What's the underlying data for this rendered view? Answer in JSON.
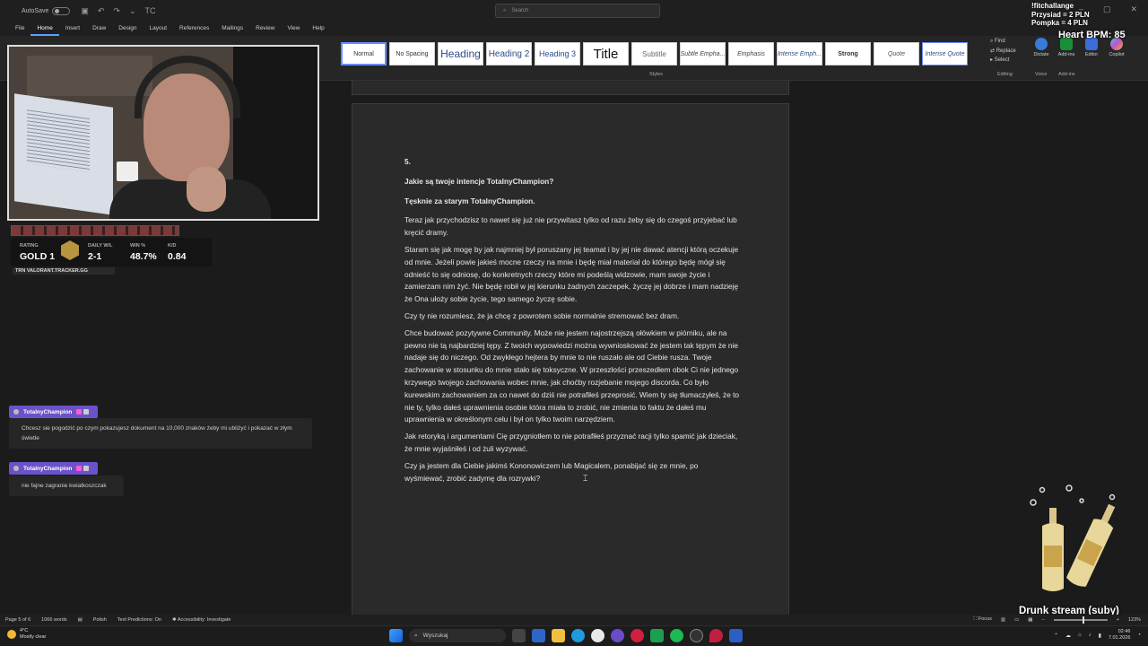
{
  "titlebar": {
    "autosave": "AutoSave",
    "search_placeholder": "Search",
    "quick_access_label": "TC"
  },
  "menu": [
    "File",
    "Home",
    "Insert",
    "Draw",
    "Design",
    "Layout",
    "References",
    "Mailings",
    "Review",
    "View",
    "Help"
  ],
  "ribbon": {
    "styles": [
      "Normal",
      "No Spacing",
      "Heading",
      "Heading 2",
      "Heading 3",
      "Title",
      "Subtitle",
      "Subtle Empha...",
      "Emphasis",
      "Intense Emph...",
      "Strong",
      "Quote",
      "Intense Quote"
    ],
    "styles_label": "Styles",
    "editing": [
      "Find",
      "Replace",
      "Select"
    ],
    "editing_label": "Editing",
    "voice": "Dictate",
    "voice_label": "Voice",
    "addins": [
      "Add-ins",
      "Editor",
      "Copilot"
    ],
    "addins_label": "Add-ins"
  },
  "document": {
    "number": "5.",
    "heading": "Jakie są twoje intencje TotalnyChampion?",
    "subheading": "Tęsknie za starym TotalnyChampion.",
    "paragraphs": [
      "Teraz jak przychodzisz to nawet się już nie przywitasz tylko od razu żeby się do czegoś przyjebać lub kręcić dramy.",
      "Staram się jak mogę by jak najmniej był poruszany jej teamat i by jej nie dawać atencji którą oczekuje od mnie. Jeżeli powie jakieś mocne rzeczy na mnie i będę miał materiał do którego będę mógł się odnieść to się odniosę, do konkretnych rzeczy które mi podeślą widzowie, mam swoje życie i zamierzam nim żyć. Nie będę robił w jej kierunku żadnych zaczepek, życzę jej dobrze i mam nadzieję że Ona ułoży sobie życie, tego samego życzę sobie.",
      "Czy ty nie rozumiesz, że ja chcę z powrotem sobie normalnie stremować bez dram.",
      "Chce budować pozytywne Community. Może nie jestem najostrzejszą ołówkiem w piórniku, ale na pewno nie tą najbardziej tępy. Z twoich wypowiedzi można wywnioskować że jestem tak tępym że nie nadaje się do niczego. Od zwykłego hejtera by mnie to nie ruszało ale od Ciebie rusza. Twoje zachowanie w stosunku do mnie stało się toksyczne. W przeszłości przeszedłem obok Ci nie jednego krzywego twojego zachowania wobec mnie, jak choćby rozjebanie mojego discorda. Co było kurewskim zachowaniem za co nawet do dziś nie potrafiłeś przeprosić.  Wiem ty się tłumaczyłeś, że to nie ty, tylko dałeś uprawnienia osobie która miała to zrobić, nie zmienia to faktu że dałeś mu uprawnienia w określonym celu i był on tylko twoim narzędziem.",
      "Jak retoryką i argumentami Cię przygniotłem to nie potrafiłeś przyznać racji tylko spamić jak dzieciak, że mnie wyjaśniłeś i od żuli wyzywać.",
      "Czy ja jestem dla Ciebie jakimś Kononowiczem lub Magicalem, ponabijać się ze mnie, po wyśmiewać, zrobić zadymę dla rozrywki?"
    ]
  },
  "tracker": {
    "rating_label": "RATING",
    "rating_value": "GOLD 1",
    "daily_label": "DAILY W/L",
    "daily_value": "2-1",
    "win_label": "WIN %",
    "win_value": "48.7%",
    "kd_label": "K/D",
    "kd_value": "0.84",
    "brand": "TRN  VALORANT.TRACKER.GG"
  },
  "chat": [
    {
      "user": "TotalnyChampion",
      "message": "Chcesz sie pogodzić po czym pokazujesz dokument na 10,000 znaków żeby mi ubliżyć i pokazać w złym świetle"
    },
    {
      "user": "TotalnyChampion",
      "message": "nie fajne zagranie kwiatkoszczak"
    }
  ],
  "overlay": {
    "lines": [
      "!fitchallange",
      "Przysiad = 2 PLN",
      "Pompka = 4 PLN"
    ],
    "bpm": "Heart BPM: 85",
    "stream_title": "Drunk stream (suby)"
  },
  "statusbar": {
    "page": "Page 5 of 6",
    "words": "1066 words",
    "language": "Polish",
    "predictions": "Text Predictions: On",
    "accessibility": "Accessibility: Investigate",
    "focus": "Focus",
    "zoom": "123%"
  },
  "taskbar": {
    "temp": "4°C",
    "weather": "Mostly clear",
    "search": "Wyszukaj",
    "time": "02:46",
    "date": "7.01.2026"
  },
  "colors": {
    "accent": "#5aa0ff",
    "twitch_purple": "#6b52c9"
  }
}
